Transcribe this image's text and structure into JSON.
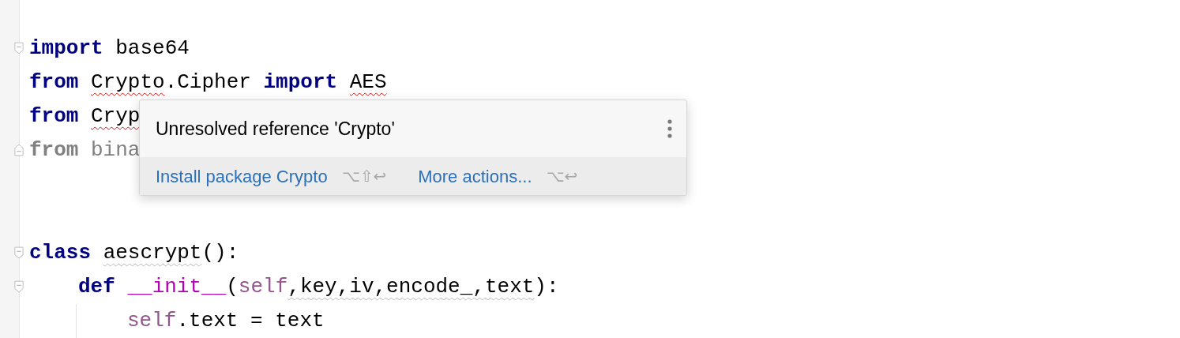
{
  "editor": {
    "lines": [
      {
        "kind": "fold_start",
        "tokens": [
          {
            "text": "import ",
            "kind": "keyword",
            "error": false,
            "warning": false
          },
          {
            "text": "base64",
            "kind": "name",
            "error": false,
            "warning": false
          }
        ]
      },
      {
        "kind": "plain",
        "tokens": [
          {
            "text": "from ",
            "kind": "keyword",
            "error": false,
            "warning": false
          },
          {
            "text": "Crypto",
            "kind": "name",
            "error": true,
            "warning": false
          },
          {
            "text": ".Cipher ",
            "kind": "name",
            "error": false,
            "warning": false
          },
          {
            "text": "import ",
            "kind": "keyword",
            "error": false,
            "warning": false
          },
          {
            "text": "AES",
            "kind": "name",
            "error": true,
            "warning": false
          }
        ]
      },
      {
        "kind": "plain",
        "tokens": [
          {
            "text": "from ",
            "kind": "keyword",
            "error": false,
            "warning": false
          },
          {
            "text": "Cryp",
            "kind": "name",
            "error": true,
            "warning": false
          }
        ]
      },
      {
        "kind": "fold_end",
        "tokens": [
          {
            "text": "from ",
            "kind": "unused_keyword",
            "error": false,
            "warning": false
          },
          {
            "text": "bina",
            "kind": "unused",
            "error": false,
            "warning": false
          }
        ]
      },
      {
        "kind": "blank"
      },
      {
        "kind": "blank"
      },
      {
        "kind": "fold_start",
        "tokens": [
          {
            "text": "class ",
            "kind": "keyword",
            "error": false,
            "warning": false
          },
          {
            "text": "aescrypt",
            "kind": "name",
            "error": false,
            "warning": true
          },
          {
            "text": "():",
            "kind": "name",
            "error": false,
            "warning": false
          }
        ],
        "children": [
          {
            "kind": "fold_start",
            "tokens": [
              {
                "text": "def ",
                "kind": "keyword",
                "error": false,
                "warning": false
              },
              {
                "text": "__init__",
                "kind": "magic",
                "error": false,
                "warning": false
              },
              {
                "text": "(",
                "kind": "name",
                "error": false,
                "warning": false
              },
              {
                "text": "self",
                "kind": "self",
                "error": false,
                "warning": false
              },
              {
                "text": ",key,iv,encode_,text",
                "kind": "name",
                "error": false,
                "warning": true
              },
              {
                "text": "):",
                "kind": "name",
                "error": false,
                "warning": false
              }
            ],
            "children": [
              {
                "kind": "plain",
                "tokens": [
                  {
                    "text": "self",
                    "kind": "self",
                    "error": false,
                    "warning": false
                  },
                  {
                    "text": ".text = text",
                    "kind": "name",
                    "error": false,
                    "warning": false
                  }
                ]
              }
            ]
          }
        ]
      }
    ]
  },
  "popup": {
    "message": "Unresolved reference 'Crypto'",
    "actions": [
      {
        "label": "Install package Crypto",
        "shortcut": "⌥⇧↩"
      },
      {
        "label": "More actions...",
        "shortcut": "⌥↩"
      }
    ]
  }
}
